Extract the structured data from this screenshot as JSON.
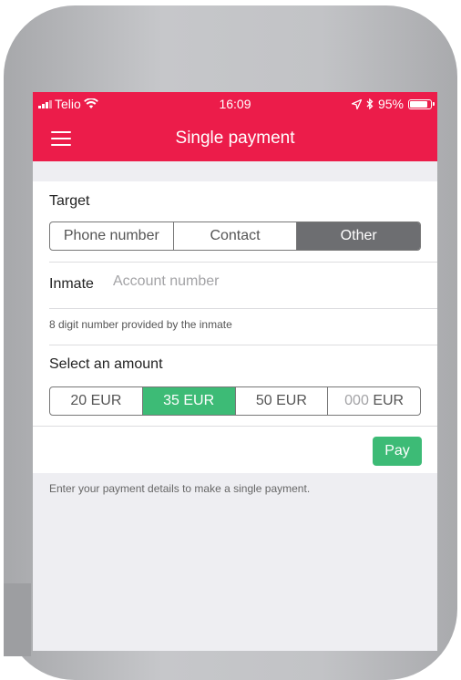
{
  "status_bar": {
    "carrier": "Telio",
    "time": "16:09",
    "battery": "95%"
  },
  "navbar": {
    "title": "Single payment"
  },
  "target": {
    "label": "Target",
    "options": [
      "Phone number",
      "Contact",
      "Other"
    ],
    "selected": "Other"
  },
  "inmate": {
    "label": "Inmate",
    "placeholder": "Account number",
    "value": ""
  },
  "hint": "8 digit number provided by the inmate",
  "amount": {
    "label": "Select an amount",
    "options": [
      "20 EUR",
      "35 EUR",
      "50 EUR"
    ],
    "selected": "35 EUR",
    "custom_placeholder": "000",
    "custom_unit": "EUR"
  },
  "pay_label": "Pay",
  "footer": "Enter your payment details to make a single payment.",
  "colors": {
    "brand": "#ec1c4a",
    "success": "#3dbb76",
    "segment_active": "#6d6e71"
  }
}
